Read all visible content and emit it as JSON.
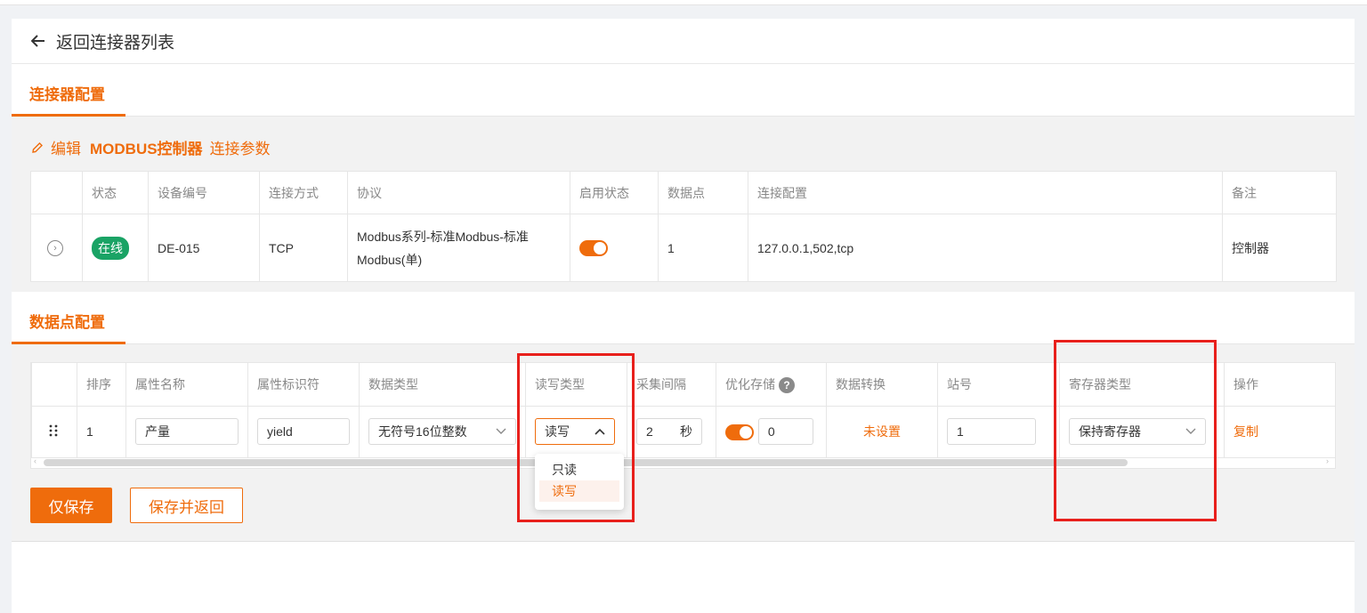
{
  "back_label": "返回连接器列表",
  "section1": {
    "tab": "连接器配置"
  },
  "edit": {
    "prefix": "编辑",
    "name": "MODBUS控制器",
    "suffix": "连接参数"
  },
  "connector_table": {
    "headers": [
      "",
      "状态",
      "设备编号",
      "连接方式",
      "协议",
      "启用状态",
      "数据点",
      "连接配置",
      "备注"
    ],
    "row": {
      "status": "在线",
      "device_id": "DE-015",
      "conn_type": "TCP",
      "protocol_line1": "Modbus系列-标准Modbus-标准",
      "protocol_line2": "Modbus(单)",
      "enabled": true,
      "points": "1",
      "config": "127.0.0.1,502,tcp",
      "remark": "控制器"
    }
  },
  "section2": {
    "tab": "数据点配置"
  },
  "points_table": {
    "headers": [
      "",
      "排序",
      "属性名称",
      "属性标识符",
      "数据类型",
      "读写类型",
      "采集间隔",
      "优化存储",
      "数据转换",
      "站号",
      "寄存器类型",
      "操作"
    ],
    "row": {
      "order": "1",
      "attr_name": "产量",
      "attr_id": "yield",
      "data_type": "无符号16位整数",
      "rw_type": "读写",
      "interval_value": "2",
      "interval_unit": "秒",
      "optimize_enabled": true,
      "optimize_value": "0",
      "conversion": "未设置",
      "station": "1",
      "register_type": "保持寄存器",
      "action": "复制"
    }
  },
  "rw_dropdown": {
    "options": [
      "只读",
      "读写"
    ],
    "selected": "读写"
  },
  "buttons": {
    "save_only": "仅保存",
    "save_return": "保存并返回"
  },
  "colors": {
    "accent": "#ef6c0c",
    "online": "#1aa365",
    "highlight_box": "#e8201c"
  }
}
